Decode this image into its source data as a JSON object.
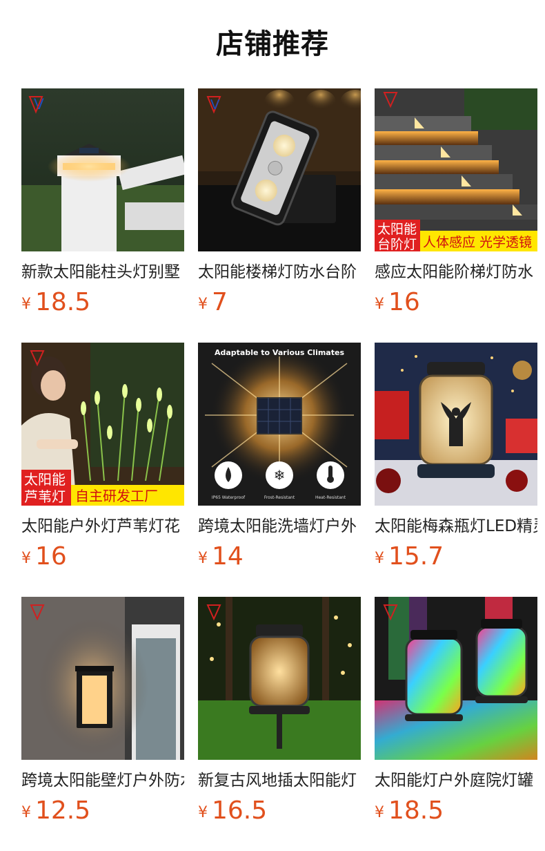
{
  "section": {
    "title": "店铺推荐"
  },
  "products": [
    {
      "title": "新款太阳能柱头灯别墅",
      "currency": "¥",
      "price": "18.5",
      "image": "solar-post-cap-light"
    },
    {
      "title": "太阳能楼梯灯防水台阶",
      "currency": "¥",
      "price": "7",
      "image": "solar-stair-light"
    },
    {
      "title": "感应太阳能阶梯灯防水",
      "currency": "¥",
      "price": "16",
      "image": "solar-step-light",
      "banner": {
        "line1": "太阳能",
        "line2": "台阶灯",
        "tagline": "人体感应 光学透镜"
      }
    },
    {
      "title": "太阳能户外灯芦苇灯花",
      "currency": "¥",
      "price": "16",
      "image": "solar-reed-light",
      "banner": {
        "line1": "太阳能",
        "line2": "芦苇灯",
        "tagline": "自主研发工厂"
      }
    },
    {
      "title": "跨境太阳能洗墙灯户外",
      "currency": "¥",
      "price": "14",
      "image": "solar-wall-washer",
      "caption": "Adaptable to Various Climates",
      "features": [
        "IP65 Waterproof",
        "Frost-Resistant",
        "Heat-Resistant"
      ]
    },
    {
      "title": "太阳能梅森瓶灯LED精灵",
      "currency": "¥",
      "price": "15.7",
      "image": "solar-mason-jar-fairy"
    },
    {
      "title": "跨境太阳能壁灯户外防水",
      "currency": "¥",
      "price": "12.5",
      "image": "solar-wall-lantern"
    },
    {
      "title": "新复古风地插太阳能灯",
      "currency": "¥",
      "price": "16.5",
      "image": "solar-stake-jar-light"
    },
    {
      "title": "太阳能灯户外庭院灯罐",
      "currency": "¥",
      "price": "18.5",
      "image": "solar-rgb-jar-light"
    }
  ],
  "colors": {
    "price": "#e1501d",
    "title": "#222222",
    "heading": "#111111",
    "banner_red": "#e02020",
    "banner_yellow": "#ffe600"
  }
}
